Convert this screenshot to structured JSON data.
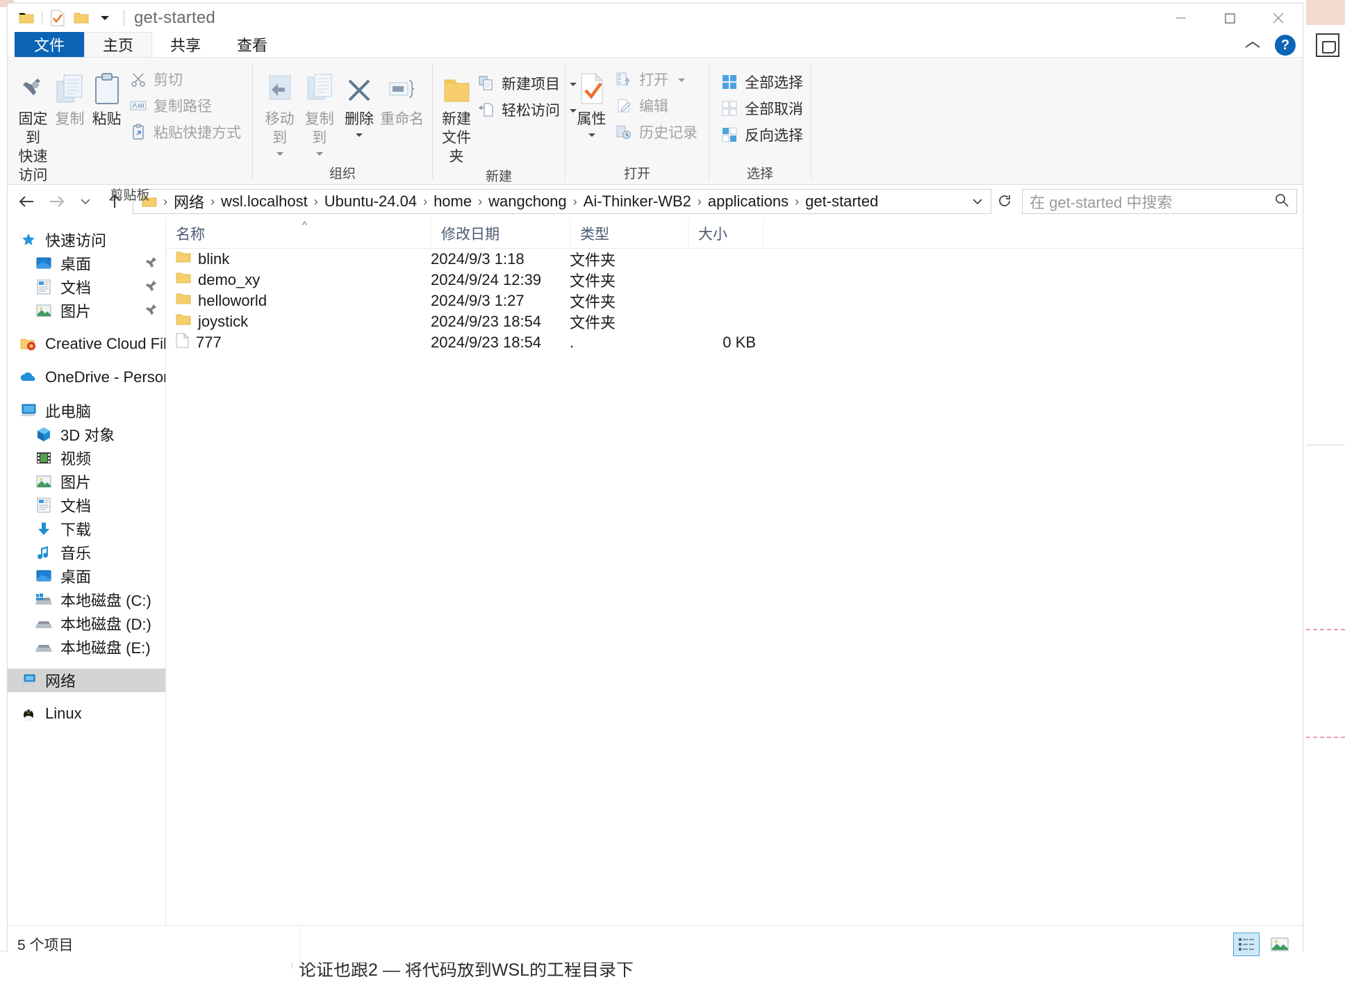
{
  "window": {
    "title": "get-started",
    "quick_access_icons": [
      "folder-icon",
      "properties-check-icon",
      "new-folder-icon",
      "chevron-down-icon"
    ],
    "controls": {
      "minimize": "minimize-icon",
      "maximize": "maximize-icon",
      "close": "close-icon"
    }
  },
  "ribbon": {
    "tabs": [
      {
        "label": "文件",
        "kind": "file"
      },
      {
        "label": "主页",
        "kind": "active"
      },
      {
        "label": "共享",
        "kind": "normal"
      },
      {
        "label": "查看",
        "kind": "normal"
      }
    ],
    "collapse_icon": "chevron-up-icon",
    "help_label": "?",
    "groups": [
      {
        "name": "clipboard",
        "label": "剪贴板",
        "big": [
          {
            "label_line1": "固定到",
            "label_line2": "快速访问",
            "icon": "pin-icon",
            "dim": false
          },
          {
            "label_line1": "复制",
            "label_line2": "",
            "icon": "copy-icon",
            "dim": true
          },
          {
            "label_line1": "粘贴",
            "label_line2": "",
            "icon": "paste-icon",
            "dim": false
          }
        ],
        "small": [
          {
            "label": "剪切",
            "icon": "scissors-icon",
            "dim": true
          },
          {
            "label": "复制路径",
            "icon": "copy-path-icon",
            "dim": true
          },
          {
            "label": "粘贴快捷方式",
            "icon": "paste-shortcut-icon",
            "dim": true
          }
        ]
      },
      {
        "name": "organize",
        "label": "组织",
        "big": [
          {
            "label_line1": "移动到",
            "label_line2": "",
            "icon": "move-to-icon",
            "dim": true,
            "caret": true
          },
          {
            "label_line1": "复制到",
            "label_line2": "",
            "icon": "copy-to-icon",
            "dim": true,
            "caret": true
          },
          {
            "label_line1": "删除",
            "label_line2": "",
            "icon": "delete-x-icon",
            "dim": false,
            "caret": true
          },
          {
            "label_line1": "重命名",
            "label_line2": "",
            "icon": "rename-icon",
            "dim": true
          }
        ],
        "small": []
      },
      {
        "name": "new",
        "label": "新建",
        "big": [
          {
            "label_line1": "新建",
            "label_line2": "文件夹",
            "icon": "new-folder-icon",
            "dim": false
          }
        ],
        "small": [
          {
            "label": "新建项目",
            "icon": "new-item-icon",
            "dim": false,
            "caret": true
          },
          {
            "label": "轻松访问",
            "icon": "easy-access-icon",
            "dim": false,
            "caret": true
          }
        ]
      },
      {
        "name": "open",
        "label": "打开",
        "big": [
          {
            "label_line1": "属性",
            "label_line2": "",
            "icon": "properties-check-icon",
            "dim": false,
            "caret": true
          }
        ],
        "small": [
          {
            "label": "打开",
            "icon": "open-icon",
            "dim": true,
            "caret": true
          },
          {
            "label": "编辑",
            "icon": "edit-icon",
            "dim": true
          },
          {
            "label": "历史记录",
            "icon": "history-icon",
            "dim": true
          }
        ]
      },
      {
        "name": "select",
        "label": "选择",
        "big": [],
        "small": [
          {
            "label": "全部选择",
            "icon": "select-all-icon",
            "dim": false
          },
          {
            "label": "全部取消",
            "icon": "select-none-icon",
            "dim": false
          },
          {
            "label": "反向选择",
            "icon": "invert-selection-icon",
            "dim": false
          }
        ]
      }
    ]
  },
  "address": {
    "back_icon": "arrow-left-icon",
    "forward_icon": "arrow-right-icon",
    "recent_icon": "chevron-down-icon",
    "up_icon": "arrow-up-icon",
    "leading_icon": "folder-icon",
    "crumbs": [
      "网络",
      "wsl.localhost",
      "Ubuntu-24.04",
      "home",
      "wangchong",
      "Ai-Thinker-WB2",
      "applications",
      "get-started"
    ],
    "separator": "›",
    "dropdown_icon": "chevron-down-icon",
    "refresh_icon": "refresh-icon",
    "search_placeholder": "在 get-started 中搜索",
    "search_icon": "search-icon"
  },
  "sidebar": {
    "items": [
      {
        "label": "快速访问",
        "icon": "star-icon",
        "level": 0,
        "pinned": false,
        "selected": false
      },
      {
        "label": "桌面",
        "icon": "desktop-icon",
        "level": 1,
        "pinned": true,
        "selected": false
      },
      {
        "label": "文档",
        "icon": "documents-icon",
        "level": 1,
        "pinned": true,
        "selected": false
      },
      {
        "label": "图片",
        "icon": "pictures-icon",
        "level": 1,
        "pinned": true,
        "selected": false
      },
      {
        "label": "Creative Cloud Files",
        "icon": "creative-cloud-icon",
        "level": 0,
        "pinned": false,
        "selected": false,
        "gap_before": true
      },
      {
        "label": "OneDrive - Persona",
        "icon": "onedrive-icon",
        "level": 0,
        "pinned": false,
        "selected": false,
        "gap_before": true
      },
      {
        "label": "此电脑",
        "icon": "this-pc-icon",
        "level": 0,
        "pinned": false,
        "selected": false,
        "gap_before": true
      },
      {
        "label": "3D 对象",
        "icon": "3d-objects-icon",
        "level": 1,
        "pinned": false,
        "selected": false
      },
      {
        "label": "视频",
        "icon": "videos-icon",
        "level": 1,
        "pinned": false,
        "selected": false
      },
      {
        "label": "图片",
        "icon": "pictures-icon",
        "level": 1,
        "pinned": false,
        "selected": false
      },
      {
        "label": "文档",
        "icon": "documents-icon",
        "level": 1,
        "pinned": false,
        "selected": false
      },
      {
        "label": "下载",
        "icon": "downloads-icon",
        "level": 1,
        "pinned": false,
        "selected": false
      },
      {
        "label": "音乐",
        "icon": "music-icon",
        "level": 1,
        "pinned": false,
        "selected": false
      },
      {
        "label": "桌面",
        "icon": "desktop-icon",
        "level": 1,
        "pinned": false,
        "selected": false
      },
      {
        "label": "本地磁盘 (C:)",
        "icon": "windows-drive-icon",
        "level": 1,
        "pinned": false,
        "selected": false
      },
      {
        "label": "本地磁盘 (D:)",
        "icon": "drive-icon",
        "level": 1,
        "pinned": false,
        "selected": false
      },
      {
        "label": "本地磁盘 (E:)",
        "icon": "drive-icon",
        "level": 1,
        "pinned": false,
        "selected": false
      },
      {
        "label": "网络",
        "icon": "network-icon",
        "level": 0,
        "pinned": false,
        "selected": true,
        "gap_before": true
      },
      {
        "label": "Linux",
        "icon": "linux-penguin-icon",
        "level": 0,
        "pinned": false,
        "selected": false,
        "gap_before": true
      }
    ]
  },
  "filelist": {
    "columns": [
      {
        "key": "name",
        "label": "名称"
      },
      {
        "key": "date",
        "label": "修改日期"
      },
      {
        "key": "type",
        "label": "类型"
      },
      {
        "key": "size",
        "label": "大小"
      }
    ],
    "sort_indicator": "^",
    "rows": [
      {
        "name": "blink",
        "date": "2024/9/3 1:18",
        "type": "文件夹",
        "size": "",
        "icon": "folder-icon"
      },
      {
        "name": "demo_xy",
        "date": "2024/9/24 12:39",
        "type": "文件夹",
        "size": "",
        "icon": "folder-icon"
      },
      {
        "name": "helloworld",
        "date": "2024/9/3 1:27",
        "type": "文件夹",
        "size": "",
        "icon": "folder-icon"
      },
      {
        "name": "joystick",
        "date": "2024/9/23 18:54",
        "type": "文件夹",
        "size": "",
        "icon": "folder-icon"
      },
      {
        "name": "777",
        "date": "2024/9/23 18:54",
        "type": ".",
        "size": "0 KB",
        "icon": "file-icon"
      }
    ]
  },
  "statusbar": {
    "item_count": "5 个项目",
    "views": [
      {
        "name": "details-view-icon",
        "selected": true
      },
      {
        "name": "large-icons-view-icon",
        "selected": false
      }
    ]
  },
  "background": {
    "bottom_text": "论证也跟2 — 将代码放到WSL的工程目录下"
  },
  "colors": {
    "accent": "#0b64b5",
    "folder": "#f7ce6b",
    "selection": "#d4d4d4",
    "view_selected": "#cde8f7"
  }
}
